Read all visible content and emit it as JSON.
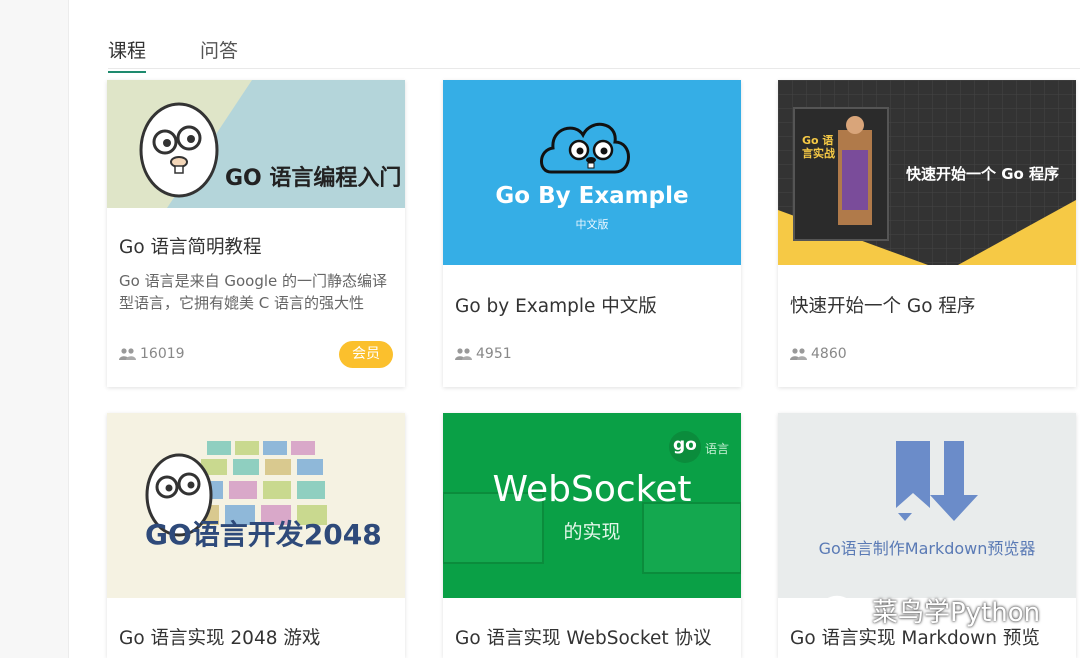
{
  "tabs": [
    {
      "label": "课程",
      "active": true
    },
    {
      "label": "问答",
      "active": false
    }
  ],
  "cards": [
    {
      "title": "Go 语言简明教程",
      "desc": "Go 语言是来自 Google 的一门静态编译型语言，它拥有媲美 C 语言的强大性能，设计者赋予了它丰富的语言特性",
      "count": "16019",
      "badge": "会员",
      "cover_text": "GO 语言编程入门"
    },
    {
      "title": "Go by Example 中文版",
      "count": "4951",
      "cover_title": "Go By Example",
      "cover_sub": "中文版"
    },
    {
      "title": "快速开始一个 Go 程序",
      "count": "4860",
      "cover_text": "快速开始一个 Go 程序",
      "book_title": "Go 语言实战"
    },
    {
      "title": "Go 语言实现 2048 游戏",
      "cover_text": "GO语言开发2048"
    },
    {
      "title": "Go 语言实现 WebSocket 协议",
      "cover_title": "WebSocket",
      "cover_sub": "的实现",
      "logo_go": "go",
      "logo_lang": "语言"
    },
    {
      "title": "Go 语言实现 Markdown 预览",
      "cover_text": "Go语言制作Markdown预览器"
    }
  ],
  "watermark": "菜鸟学Python",
  "colors": {
    "accent": "#1e8a6e",
    "badge": "#fbc02d",
    "blue": "#35aee6",
    "green": "#0aa046"
  }
}
